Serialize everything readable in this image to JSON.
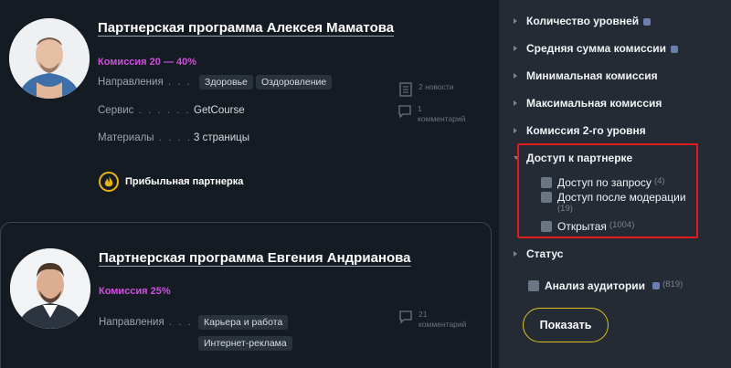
{
  "cards": [
    {
      "title": "Партнерская программа Алексея Маматова",
      "commission": "Комиссия 20 — 40%",
      "directions_label": "Направления",
      "directions": [
        "Здоровье",
        "Оздоровление"
      ],
      "service_label": "Сервис",
      "service": "GetCourse",
      "materials_label": "Материалы",
      "materials": "3 страницы",
      "news": "2 новости",
      "comments_count": "1",
      "comments_word": "комментарий",
      "badge": "Прибыльная партнерка"
    },
    {
      "title": "Партнерская программа Евгения Андрианова",
      "commission": "Комиссия 25%",
      "directions_label": "Направления",
      "directions": [
        "Карьера и работа",
        "Интернет-реклама"
      ],
      "comments_count": "21",
      "comments_word": "комментарий"
    }
  ],
  "filters": {
    "levels": "Количество уровней",
    "avg_commission": "Средняя сумма комиссии",
    "min_commission": "Минимальная комиссия",
    "max_commission": "Максимальная комиссия",
    "commission_level2": "Комиссия 2-го уровня",
    "access": {
      "label": "Доступ к партнерке",
      "options": [
        {
          "label": "Доступ по запросу",
          "count": "(4)"
        },
        {
          "label": "Доступ после модерации",
          "count": "(19)"
        },
        {
          "label": "Открытая",
          "count": "(1004)"
        }
      ]
    },
    "status": "Статус",
    "audience": {
      "label": "Анализ аудитории",
      "count": "(819)"
    },
    "show_button": "Показать"
  },
  "colors": {
    "accent_purple": "#d04fe0",
    "accent_yellow": "#e2c11f",
    "highlight_red": "#e11b1b",
    "background": "#151b22",
    "sidebar_background": "#242b34"
  }
}
